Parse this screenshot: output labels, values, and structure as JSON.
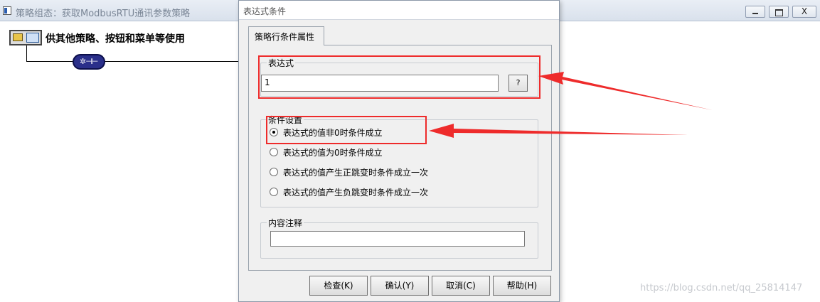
{
  "background_window": {
    "title": "策略组态：获取ModbusRTU通讯参数策略",
    "close_glyph": "X",
    "strategy_label": "供其他策略、按钮和菜单等使用",
    "node_glyph": "✲⊣⊢"
  },
  "dialog": {
    "title": "表达式条件",
    "tab_label": "策略行条件属性",
    "expression": {
      "label": "表达式",
      "value": "1",
      "help_button": "?"
    },
    "condition_settings": {
      "label": "条件设置",
      "options": [
        {
          "label": "表达式的值非0时条件成立",
          "checked": true
        },
        {
          "label": "表达式的值为0时条件成立",
          "checked": false
        },
        {
          "label": "表达式的值产生正跳变时条件成立一次",
          "checked": false
        },
        {
          "label": "表达式的值产生负跳变时条件成立一次",
          "checked": false
        }
      ]
    },
    "comment": {
      "label": "内容注释",
      "value": ""
    },
    "buttons": {
      "check": "检查(K)",
      "ok": "确认(Y)",
      "cancel": "取消(C)",
      "help": "帮助(H)"
    }
  },
  "annotation_color": "#ee2b2b",
  "watermark": "https://blog.csdn.net/qq_25814147"
}
